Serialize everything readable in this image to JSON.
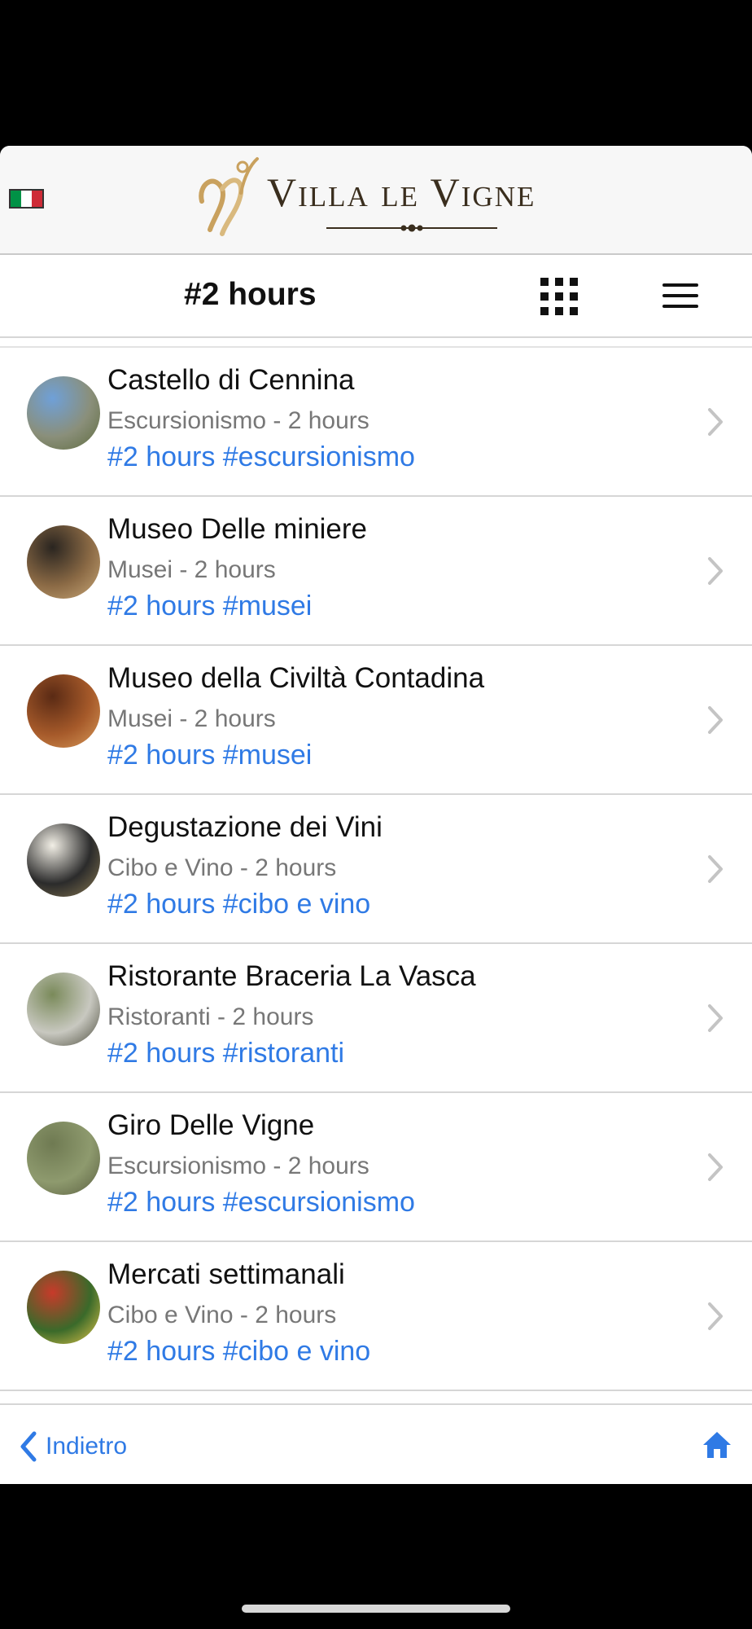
{
  "brand": {
    "name": "Villa le Vigne",
    "flag_icon": "italian-flag-icon",
    "flag_colors": [
      "#009246",
      "#ffffff",
      "#ce2b37"
    ],
    "gold": "#c9a15e"
  },
  "nav": {
    "title": "#2 hours",
    "grid_icon": "grid-icon",
    "menu_icon": "hamburger-menu-icon"
  },
  "items": [
    {
      "title": "Castello di Cennina",
      "subtitle": "Escursionismo - 2 hours",
      "tags": "#2 hours #escursionismo",
      "thumb_colors": [
        "#6fa0d8",
        "#8a8f7a",
        "#5e6b3e"
      ]
    },
    {
      "title": "Museo Delle miniere",
      "subtitle": "Musei - 2 hours",
      "tags": "#2 hours #musei",
      "thumb_colors": [
        "#2a2520",
        "#8b6a45",
        "#c9a878"
      ]
    },
    {
      "title": "Museo della Civiltà Contadina",
      "subtitle": "Musei - 2 hours",
      "tags": "#2 hours #musei",
      "thumb_colors": [
        "#5a2a14",
        "#a65a2a",
        "#d89a5a"
      ]
    },
    {
      "title": "Degustazione dei Vini",
      "subtitle": "Cibo e Vino - 2 hours",
      "tags": "#2 hours #cibo e vino",
      "thumb_colors": [
        "#f2efe6",
        "#2b2b2b",
        "#8a7a52"
      ]
    },
    {
      "title": "Ristorante Braceria La Vasca",
      "subtitle": "Ristoranti - 2 hours",
      "tags": "#2 hours #ristoranti",
      "thumb_colors": [
        "#7a8a5a",
        "#c8c8c0",
        "#4a4a3a"
      ]
    },
    {
      "title": "Giro Delle Vigne",
      "subtitle": "Escursionismo - 2 hours",
      "tags": "#2 hours #escursionismo",
      "thumb_colors": [
        "#6f7a52",
        "#8e9a6e",
        "#5a5f40"
      ]
    },
    {
      "title": "Mercati settimanali",
      "subtitle": "Cibo e Vino - 2 hours",
      "tags": "#2 hours #cibo e vino",
      "thumb_colors": [
        "#c83a2a",
        "#3a6a2a",
        "#e8c84a"
      ]
    }
  ],
  "footer": {
    "back_label": "Indietro",
    "back_icon": "chevron-left-icon",
    "home_icon": "home-icon",
    "accent": "#2f7ae5"
  }
}
